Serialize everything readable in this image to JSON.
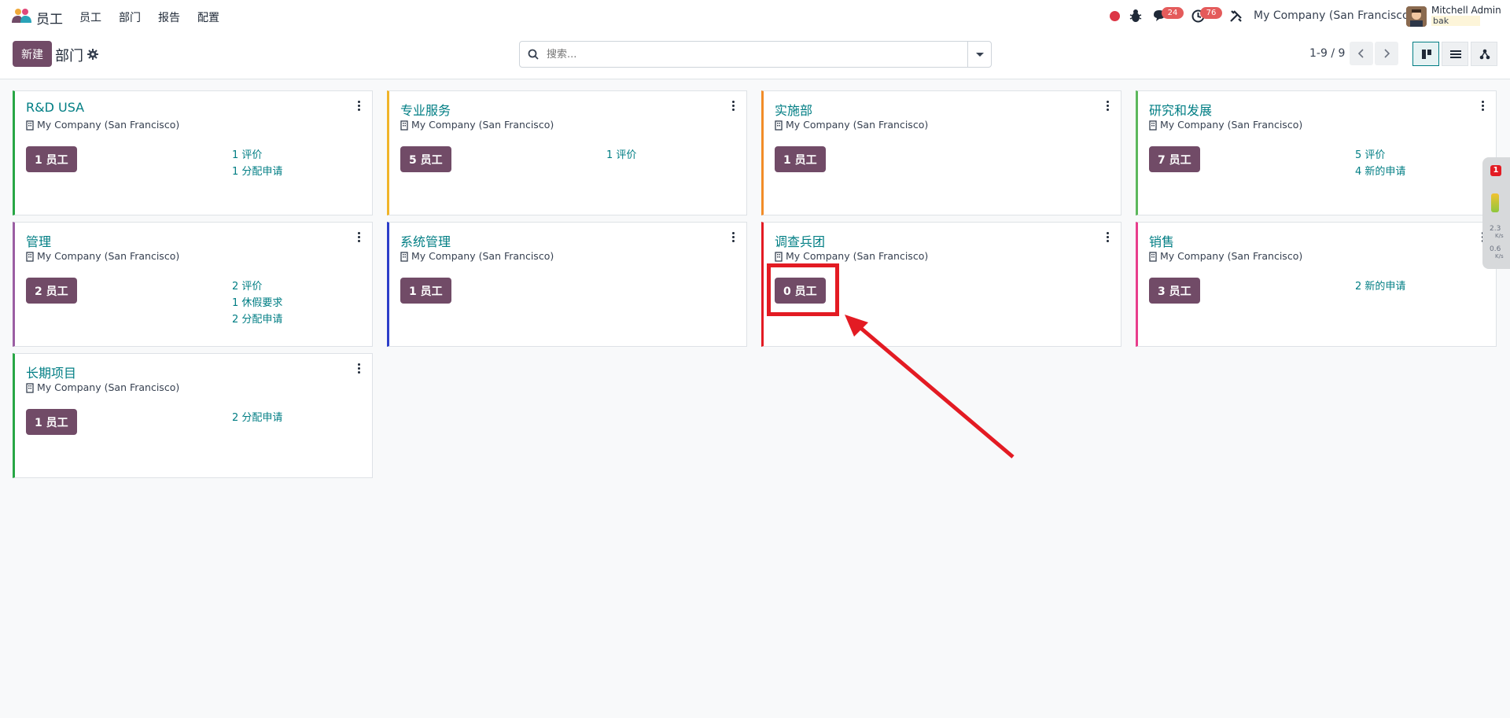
{
  "navbar": {
    "app_name": "员工",
    "menu": [
      "员工",
      "部门",
      "报告",
      "配置"
    ],
    "chat_badge": "24",
    "activity_badge": "76",
    "company": "My Company (San Francisco)",
    "user_name": "Mitchell Admin",
    "db_name": "bak"
  },
  "control_panel": {
    "new_label": "新建",
    "title": "部门",
    "search_placeholder": "搜索...",
    "pager": "1-9 / 9"
  },
  "cards": [
    {
      "title": "R&D USA",
      "company": "My Company (San Francisco)",
      "employees": "1 员工",
      "accent": "#28a745",
      "stats": [
        "1 评价",
        "1 分配申请"
      ]
    },
    {
      "title": "专业服务",
      "company": "My Company (San Francisco)",
      "employees": "5 员工",
      "accent": "#f0b429",
      "stats": [
        "1 评价"
      ]
    },
    {
      "title": "实施部",
      "company": "My Company (San Francisco)",
      "employees": "1 员工",
      "accent": "#f28c28",
      "stats": []
    },
    {
      "title": "研究和发展",
      "company": "My Company (San Francisco)",
      "employees": "7 员工",
      "accent": "#5cb85c",
      "stats": [
        "5 评价",
        "4 新的申请"
      ]
    },
    {
      "title": "管理",
      "company": "My Company (San Francisco)",
      "employees": "2 员工",
      "accent": "#9b5ea3",
      "stats": [
        "2 评价",
        "1 休假要求",
        "2 分配申请"
      ]
    },
    {
      "title": "系统管理",
      "company": "My Company (San Francisco)",
      "employees": "1 员工",
      "accent": "#2c3ec9",
      "stats": []
    },
    {
      "title": "调查兵团",
      "company": "My Company (San Francisco)",
      "employees": "0 员工",
      "accent": "#e31b23",
      "stats": []
    },
    {
      "title": "销售",
      "company": "My Company (San Francisco)",
      "employees": "3 员工",
      "accent": "#e83e8c",
      "stats": [
        "2 新的申请"
      ]
    },
    {
      "title": "长期项目",
      "company": "My Company (San Francisco)",
      "employees": "1 员工",
      "accent": "#28a745",
      "stats": [
        "2 分配申请"
      ]
    }
  ],
  "side_widget": {
    "badge": "1",
    "stat1": "2.3",
    "stat2": "0.6",
    "unit": "K/s"
  },
  "colors": {
    "brand": "#714b67",
    "link": "#017e84",
    "annotation": "#e31b23"
  }
}
